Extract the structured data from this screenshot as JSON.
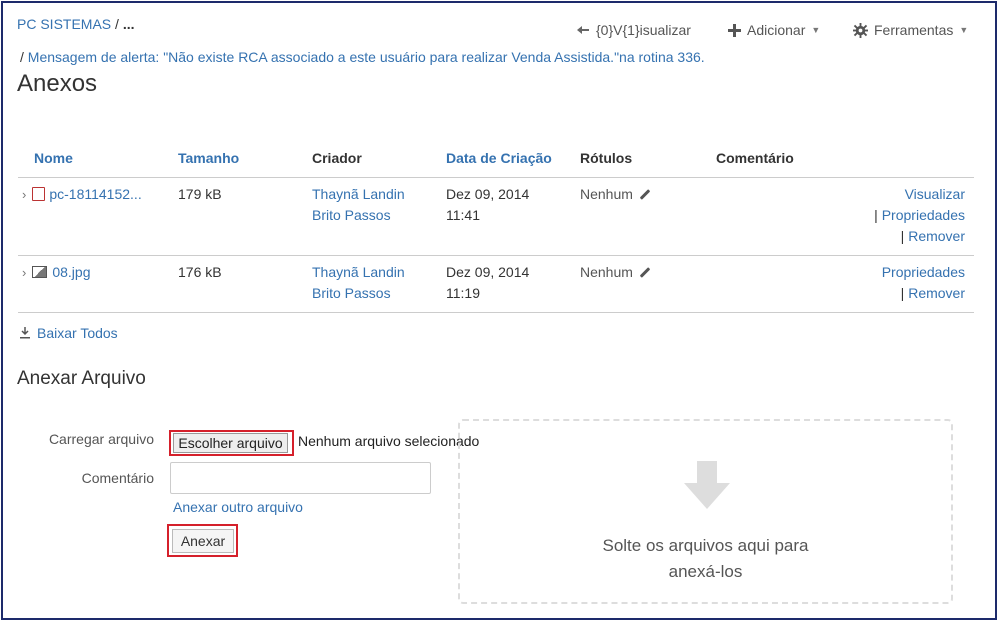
{
  "breadcrumb": {
    "root": "PC SISTEMAS",
    "separator": "/",
    "more": "..."
  },
  "toolbar": {
    "view_label": "{0}V{1}isualizar",
    "add_label": "Adicionar",
    "tools_label": "Ferramentas"
  },
  "alert_crumb": {
    "separator": "/",
    "text": "Mensagem de alerta: \"Não existe RCA associado a este usuário para realizar Venda Assistida.\"na rotina 336."
  },
  "page_title": "Anexos",
  "table": {
    "headers": {
      "name": "Nome",
      "size": "Tamanho",
      "creator": "Criador",
      "created": "Data de Criação",
      "labels": "Rótulos",
      "comment": "Comentário"
    },
    "rows": [
      {
        "name": "pc-18114152...",
        "size": "179 kB",
        "creator_line1": "Thaynã Landin",
        "creator_line2": "Brito Passos",
        "date_line1": "Dez 09, 2014",
        "date_line2": "11:41",
        "label": "Nenhum",
        "actions": [
          "Visualizar",
          "Propriedades",
          "Remover"
        ]
      },
      {
        "name": "08.jpg",
        "size": "176 kB",
        "creator_line1": "Thaynã Landin",
        "creator_line2": "Brito Passos",
        "date_line1": "Dez 09, 2014",
        "date_line2": "11:19",
        "label": "Nenhum",
        "actions": [
          "Propriedades",
          "Remover"
        ]
      }
    ],
    "action_separator": "|"
  },
  "download_all": "Baixar Todos",
  "attach": {
    "title": "Anexar Arquivo",
    "upload_label": "Carregar arquivo",
    "choose_button": "Escolher arquivo",
    "no_file": "Nenhum arquivo selecionado",
    "comment_label": "Comentário",
    "comment_value": "",
    "attach_another": "Anexar outro arquivo",
    "submit": "Anexar",
    "drop_line1": "Solte os arquivos aqui para",
    "drop_line2": "anexá-los"
  },
  "colors": {
    "link": "#3572b0",
    "highlight": "#d5202b",
    "frame": "#1d2a6b"
  }
}
